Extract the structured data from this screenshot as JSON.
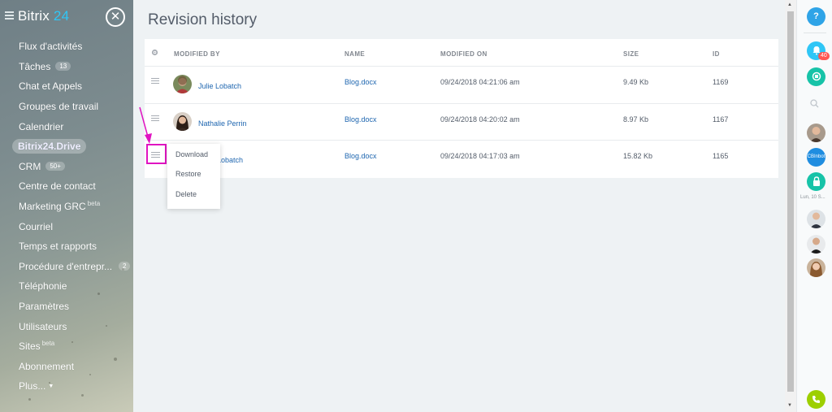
{
  "app": {
    "logo_text": "Bitrix",
    "logo_num": "24",
    "close_glyph": "✕"
  },
  "sidebar": {
    "items": [
      {
        "label": "Flux d'activités"
      },
      {
        "label": "Tâches",
        "badge": "13"
      },
      {
        "label": "Chat et Appels"
      },
      {
        "label": "Groupes de travail"
      },
      {
        "label": "Calendrier"
      },
      {
        "label": "Bitrix24.Drive",
        "active": true
      },
      {
        "label": "CRM",
        "badge": "50+"
      },
      {
        "label": "Centre de contact"
      },
      {
        "label": "Marketing GRC",
        "sup": "beta"
      },
      {
        "label": "Courriel"
      },
      {
        "label": "Temps et rapports"
      },
      {
        "label": "Procédure d'entrepr...",
        "badge": "2"
      },
      {
        "label": "Téléphonie"
      },
      {
        "label": "Paramètres"
      },
      {
        "label": "Utilisateurs"
      },
      {
        "label": "Sites",
        "sup": "beta"
      },
      {
        "label": "Abonnement"
      },
      {
        "label": "Plus..."
      }
    ]
  },
  "main": {
    "title": "Revision history",
    "columns": {
      "settings_icon": "gear-icon",
      "modified_by": "MODIFIED BY",
      "name": "NAME",
      "modified_on": "MODIFIED ON",
      "size": "SIZE",
      "id": "ID"
    },
    "rows": [
      {
        "user": "Julie Lobatch",
        "name": "Blog.docx",
        "modified_on": "09/24/2018 04:21:06 am",
        "size": "9.49 Kb",
        "id": "1169"
      },
      {
        "user": "Nathalie Perrin",
        "name": "Blog.docx",
        "modified_on": "09/24/2018 04:20:02 am",
        "size": "8.97 Kb",
        "id": "1167"
      },
      {
        "user": "Lobatch",
        "name": "Blog.docx",
        "modified_on": "09/24/2018 04:17:03 am",
        "size": "15.82 Kb",
        "id": "1165"
      }
    ],
    "context_menu": {
      "download": "Download",
      "restore": "Restore",
      "delete": "Delete"
    }
  },
  "rightbar": {
    "help": "?",
    "notif_badge": "40",
    "date_label": "Lun, 10 S...",
    "chatbot_label": "CBInbot"
  },
  "colors": {
    "accent": "#2fc6f6",
    "link": "#2067b0",
    "highlight": "#e014c1",
    "phone": "#9dcf00",
    "help": "#2fa4e7",
    "notif": "#2fc6f6",
    "lock": "#17c3a8"
  }
}
